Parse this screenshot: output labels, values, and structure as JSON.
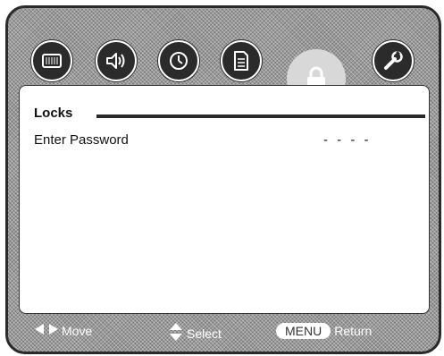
{
  "top_menu": {
    "icons": [
      {
        "name": "picture-icon"
      },
      {
        "name": "audio-icon"
      },
      {
        "name": "timer-icon"
      },
      {
        "name": "setup-icon"
      },
      {
        "name": "lock-icon",
        "active": true
      },
      {
        "name": "wrench-icon"
      }
    ]
  },
  "panel": {
    "title": "Locks",
    "row_label": "Enter Password",
    "row_value": "- - - -"
  },
  "footer": {
    "move_label": "Move",
    "select_label": "Select",
    "menu_label": "MENU",
    "return_label": "Return"
  }
}
